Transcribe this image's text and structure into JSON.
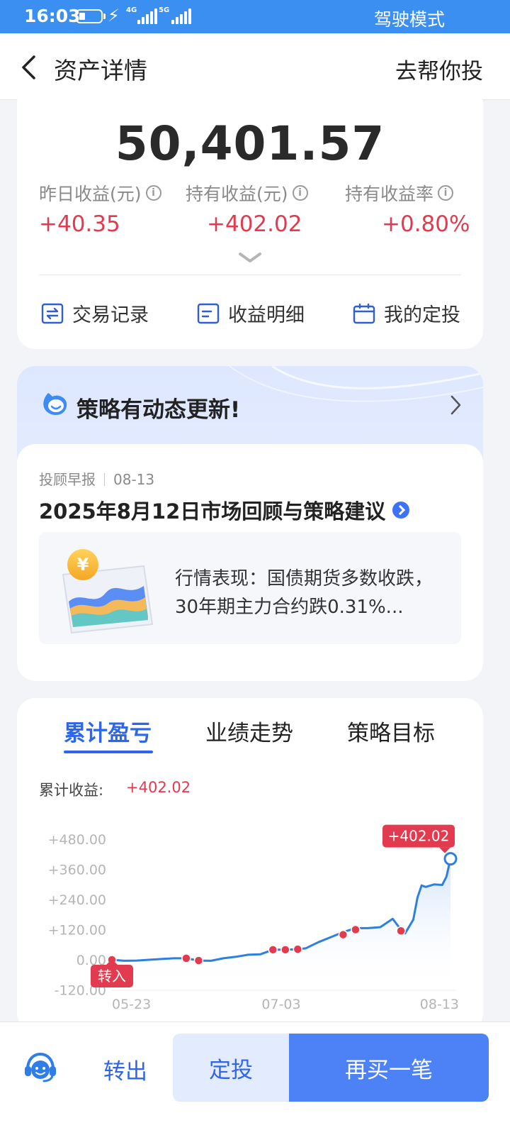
{
  "status_bar": {
    "time": "16:03",
    "network_4g": "4G",
    "network_5g": "5G",
    "mode": "驾驶模式"
  },
  "header": {
    "title": "资产详情",
    "right_action": "去帮你投"
  },
  "summary": {
    "total_assets": "50,401.57",
    "metrics": [
      {
        "label": "昨日收益(元)",
        "value": "+40.35"
      },
      {
        "label": "持有收益(元)",
        "value": "+402.02"
      },
      {
        "label": "持有收益率",
        "value": "+0.80%"
      }
    ],
    "info_icon_glyph": "i",
    "quick_actions": [
      {
        "label": "交易记录",
        "icon": "transfer-icon"
      },
      {
        "label": "收益明细",
        "icon": "list-icon"
      },
      {
        "label": "我的定投",
        "icon": "calendar-icon"
      }
    ]
  },
  "strategy": {
    "heading": "策略有动态更新!",
    "report_source": "投顾早报",
    "report_date": "08-13",
    "report_title": "2025年8月12日市场回顾与策略建议",
    "report_summary": "行情表现：国债期货多数收跌，30年期主力合约跌0.31%...",
    "coin_symbol": "¥"
  },
  "performance": {
    "tabs": [
      {
        "label": "累计盈亏",
        "active": true
      },
      {
        "label": "业绩走势",
        "active": false
      },
      {
        "label": "策略目标",
        "active": false
      }
    ],
    "cumulative_label": "累计收益:",
    "cumulative_value": "+402.02",
    "colors": {
      "line": "#2e7fe0",
      "marker": "#e23a4e",
      "accent": "#2f66e8"
    }
  },
  "chart_data": {
    "type": "line",
    "title": "",
    "xlabel": "",
    "ylabel": "",
    "ylim": [
      -120,
      480
    ],
    "y_ticks": [
      "+480.00",
      "+360.00",
      "+240.00",
      "+120.00",
      "0.00",
      "-120.00"
    ],
    "x_ticks": [
      "05-23",
      "07-03",
      "08-13"
    ],
    "x_dates": [
      "05-23",
      "05-26",
      "05-29",
      "06-01",
      "06-04",
      "06-07",
      "06-10",
      "06-13",
      "06-16",
      "06-19",
      "06-22",
      "06-25",
      "06-28",
      "07-01",
      "07-04",
      "07-07",
      "07-09",
      "07-12",
      "07-15",
      "07-18",
      "07-21",
      "07-24",
      "07-27",
      "07-30",
      "08-01",
      "08-02",
      "08-04",
      "08-05",
      "08-06",
      "08-07",
      "08-09",
      "08-11",
      "08-12",
      "08-13"
    ],
    "series": [
      {
        "values": [
          0,
          -4,
          -3,
          0,
          3,
          6,
          6,
          -3,
          -4,
          6,
          12,
          20,
          22,
          40,
          40,
          42,
          46,
          70,
          90,
          110,
          126,
          126,
          130,
          163,
          120,
          105,
          160,
          248,
          296,
          290,
          300,
          298,
          330,
          402
        ]
      }
    ],
    "transaction_markers": [
      {
        "date": "05-23",
        "value": 0
      },
      {
        "date": "06-10",
        "value": 6
      },
      {
        "date": "06-13",
        "value": -3
      },
      {
        "date": "07-01",
        "value": 40
      },
      {
        "date": "07-04",
        "value": 40
      },
      {
        "date": "07-07",
        "value": 42
      },
      {
        "date": "07-18",
        "value": 100
      },
      {
        "date": "07-21",
        "value": 120
      },
      {
        "date": "08-01",
        "value": 115
      }
    ],
    "end_label": "+402.02",
    "start_tag": "转入"
  },
  "bottom_bar": {
    "transfer_out": "转出",
    "sip": "定投",
    "buy_more": "再买一笔"
  }
}
